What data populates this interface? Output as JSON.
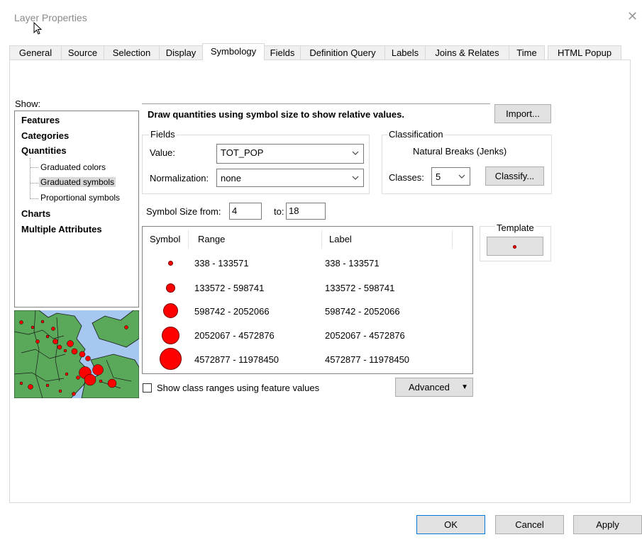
{
  "window": {
    "title": "Layer Properties",
    "close_glyph": "✕"
  },
  "tabs": [
    {
      "label": "General"
    },
    {
      "label": "Source"
    },
    {
      "label": "Selection"
    },
    {
      "label": "Display"
    },
    {
      "label": "Symbology",
      "active": true
    },
    {
      "label": "Fields"
    },
    {
      "label": "Definition Query"
    },
    {
      "label": "Labels"
    },
    {
      "label": "Joins & Relates"
    },
    {
      "label": "Time"
    },
    {
      "label": "HTML Popup"
    }
  ],
  "show": {
    "label": "Show:",
    "items": {
      "features": "Features",
      "categories": "Categories",
      "quantities": "Quantities",
      "graduated_colors": "Graduated colors",
      "graduated_symbols": "Graduated symbols",
      "proportional_symbols": "Proportional symbols",
      "charts": "Charts",
      "multiple_attributes": "Multiple Attributes"
    },
    "selected": "graduated_symbols"
  },
  "description": "Draw quantities using symbol size to show relative values.",
  "import_button": "Import...",
  "fields": {
    "group_label": "Fields",
    "value_label": "Value:",
    "value": "TOT_POP",
    "normalization_label": "Normalization:",
    "normalization": "none"
  },
  "classification": {
    "group_label": "Classification",
    "method": "Natural Breaks (Jenks)",
    "classes_label": "Classes:",
    "classes": "5",
    "classify_button": "Classify..."
  },
  "symbol_size": {
    "from_label": "Symbol Size from:",
    "from": "4",
    "to_label": "to:",
    "to": "18"
  },
  "template": {
    "label": "Template"
  },
  "table": {
    "headers": {
      "symbol": "Symbol",
      "range": "Range",
      "label": "Label"
    },
    "rows": [
      {
        "range": "338 - 133571",
        "label": "338 - 133571",
        "size": 4
      },
      {
        "range": "133572 - 598741",
        "label": "133572 - 598741",
        "size": 7.5
      },
      {
        "range": "598742 - 2052066",
        "label": "598742 - 2052066",
        "size": 11
      },
      {
        "range": "2052067 - 4572876",
        "label": "2052067 - 4572876",
        "size": 14.5
      },
      {
        "range": "4572877 - 11978450",
        "label": "4572877 - 11978450",
        "size": 18
      }
    ]
  },
  "show_class_ranges": {
    "label": "Show class ranges using feature values",
    "checked": false
  },
  "advanced_button": "Advanced",
  "buttons": {
    "ok": "OK",
    "cancel": "Cancel",
    "apply": "Apply"
  },
  "colors": {
    "symbol_fill": "#ff0000",
    "water": "#a6c8f0",
    "land": "#5aa85a"
  }
}
